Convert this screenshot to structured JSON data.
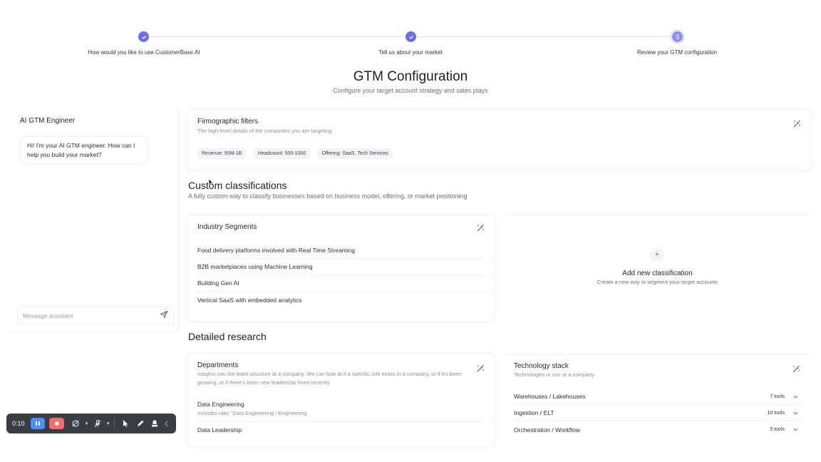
{
  "stepper": {
    "steps": [
      {
        "label": "How would you like to use CustomerBase.AI",
        "state": "done",
        "number": ""
      },
      {
        "label": "Tell us about your market",
        "state": "done",
        "number": ""
      },
      {
        "label": "Review your GTM configuration",
        "state": "current",
        "number": "3"
      }
    ]
  },
  "page": {
    "title": "GTM Configuration",
    "subtitle": "Configure your target account strategy and sales plays"
  },
  "chat": {
    "title": "AI GTM Engineer",
    "message": "Hi! I'm your AI GTM engineer. How can I help you build your market?",
    "input_placeholder": "Message assistant",
    "send_icon": "send-icon"
  },
  "firmographic": {
    "title": "Firmographic filters",
    "description": "The high-level details of the companies you are targeting",
    "chips": [
      "Revenue: 50M-1B",
      "Headcount: 500-1000",
      "Offering: SaaS, Tech Services"
    ],
    "edit_icon": "magic-wand-icon"
  },
  "custom": {
    "title": "Custom classifications",
    "subtitle": "A fully custom way to classify businesses based on business model, offering, or market positioning",
    "industry": {
      "title": "Industry Segments",
      "items": [
        "Food delivery platforms involved with Real Time Streaming",
        "B2B marketplaces using Machine Learning",
        "Building Gen AI",
        "Vertical SaaS with embedded analytics"
      ]
    },
    "add": {
      "plus": "+",
      "title": "Add new classification",
      "description": "Create a new way to segment your target accounts"
    }
  },
  "research": {
    "title": "Detailed research",
    "departments": {
      "title": "Departments",
      "description": "Insights into the team structure at a company. We can look at if a specific role exists in a company, or if it's been growing, or if there's been new leadership hired recently",
      "items": [
        {
          "name": "Data Engineering",
          "detail": "Includes ratio \"Data Engineering / Engineering"
        },
        {
          "name": "Data Leadership",
          "detail": ""
        }
      ]
    },
    "tech": {
      "title": "Technology stack",
      "description": "Technologies in use at a company",
      "items": [
        {
          "name": "Warehouses / Lakehouses",
          "count": "7 tools"
        },
        {
          "name": "Ingestion / ELT",
          "count": "10 tools"
        },
        {
          "name": "Orchestration / Workflow",
          "count": "5 tools"
        }
      ]
    }
  },
  "recorder": {
    "time": "0:10",
    "pause_color": "#4f8ef7",
    "stop_color": "#f26b6b"
  },
  "colors": {
    "accent": "#6c6ee6"
  }
}
